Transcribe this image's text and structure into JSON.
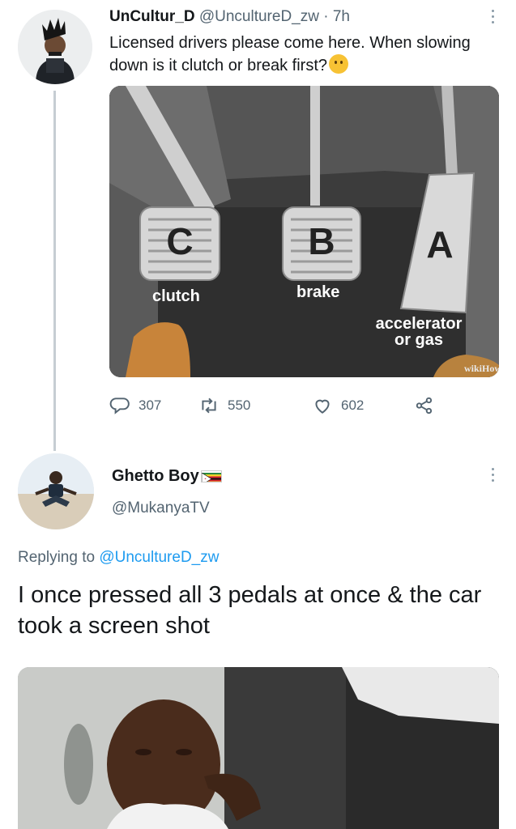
{
  "tweet1": {
    "display_name": "UnCultur_D",
    "handle": "@UncultureD_zw",
    "separator": " · ",
    "time": "7h",
    "text": "Licensed drivers please come here. When slowing down is it clutch or break first?",
    "emoji": "thinking-face",
    "media": {
      "pedal_letters": [
        "C",
        "B",
        "A"
      ],
      "pedal_labels": [
        "clutch",
        "brake",
        "accelerator",
        "or gas"
      ],
      "watermark": "wikiHow"
    },
    "actions": {
      "replies": "307",
      "retweets": "550",
      "likes": "602"
    }
  },
  "tweet2": {
    "display_name": "Ghetto Boy",
    "handle": "@MukanyaTV",
    "replying_prefix": "Replying to ",
    "replying_to": "@UncultureD_zw",
    "text": "I once pressed all 3 pedals at once & the car took a screen shot"
  },
  "colors": {
    "link": "#1d9bf0",
    "secondary_text": "#536471",
    "thread_line": "#c6cdd3"
  }
}
